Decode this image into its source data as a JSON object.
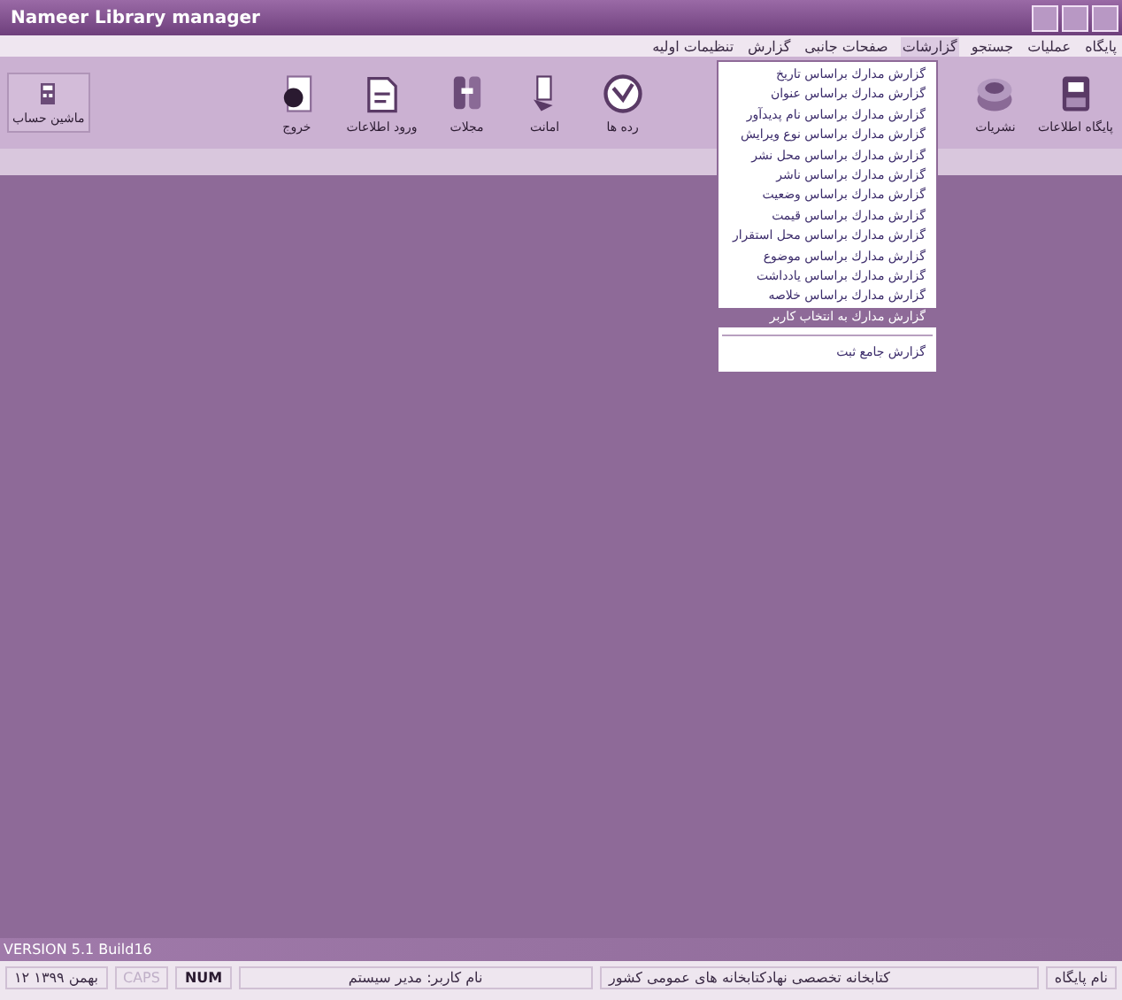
{
  "window": {
    "title": "Nameer Library manager"
  },
  "menu_bar": [
    {
      "label": "پایگاه",
      "open": false
    },
    {
      "label": "عملیات",
      "open": false
    },
    {
      "label": "جستجو",
      "open": false
    },
    {
      "label": "گزارشات",
      "open": true
    },
    {
      "label": "صفحات جانبی",
      "open": false
    },
    {
      "label": "گزارش",
      "open": false
    },
    {
      "label": "تنظیمات اولیه",
      "open": false
    }
  ],
  "toolbar_right": [
    {
      "label": "پایگاه اطلاعات"
    },
    {
      "label": "نشریات"
    }
  ],
  "toolbar_main": [
    {
      "label": "رده ها"
    },
    {
      "label": "امانت"
    },
    {
      "label": "مجلات"
    },
    {
      "label": "ورود اطلاعات"
    },
    {
      "label": "خروج"
    }
  ],
  "toolbar_left": [
    {
      "label": "ماشین حساب"
    }
  ],
  "dropdown": [
    {
      "kind": "item",
      "label": "گزارش مدارك براساس تاريخ",
      "selected": false
    },
    {
      "kind": "item",
      "label": "گزارش مدارك براساس عنوان",
      "selected": false
    },
    {
      "kind": "item",
      "label": "گزارش مدارك براساس نام پديدآور",
      "selected": false
    },
    {
      "kind": "item",
      "label": "گزارش مدارك براساس نوع ويرايش",
      "selected": false
    },
    {
      "kind": "item",
      "label": "گزارش مدارك براساس محل نشر",
      "selected": false
    },
    {
      "kind": "item",
      "label": "گزارش مدارك براساس ناشر",
      "selected": false
    },
    {
      "kind": "item",
      "label": "گزارش مدارك براساس وضعيت",
      "selected": false
    },
    {
      "kind": "item",
      "label": "گزارش مدارك براساس قيمت",
      "selected": false
    },
    {
      "kind": "item",
      "label": "گزارش مدارك براساس محل استقرار",
      "selected": false
    },
    {
      "kind": "item",
      "label": "گزارش مدارك براساس موضوع",
      "selected": false
    },
    {
      "kind": "item",
      "label": "گزارش مدارك براساس يادداشت",
      "selected": false
    },
    {
      "kind": "item",
      "label": "گزارش مدارك براساس خلاصه",
      "selected": false
    },
    {
      "kind": "item",
      "label": "گزارش مدارك به انتخاب كاربر",
      "selected": true
    },
    {
      "kind": "separator"
    },
    {
      "kind": "item",
      "label": "گزارش جامع ثبت",
      "selected": false
    }
  ],
  "version": "VERSION 5.1 Build16",
  "status_bar": [
    {
      "kind": "text",
      "text": "نام پایگاه"
    },
    {
      "kind": "text",
      "text": "کتابخانه تخصصی نهادکتابخانه های عمومی کشور"
    },
    {
      "kind": "text",
      "text": "نام کاربر: مدیر سیستم"
    },
    {
      "kind": "key",
      "text": "NUM",
      "disabled": false
    },
    {
      "kind": "key",
      "text": "CAPS",
      "disabled": true
    },
    {
      "kind": "text",
      "text": "۱۲ بهمن ۱۳۹۹"
    }
  ]
}
